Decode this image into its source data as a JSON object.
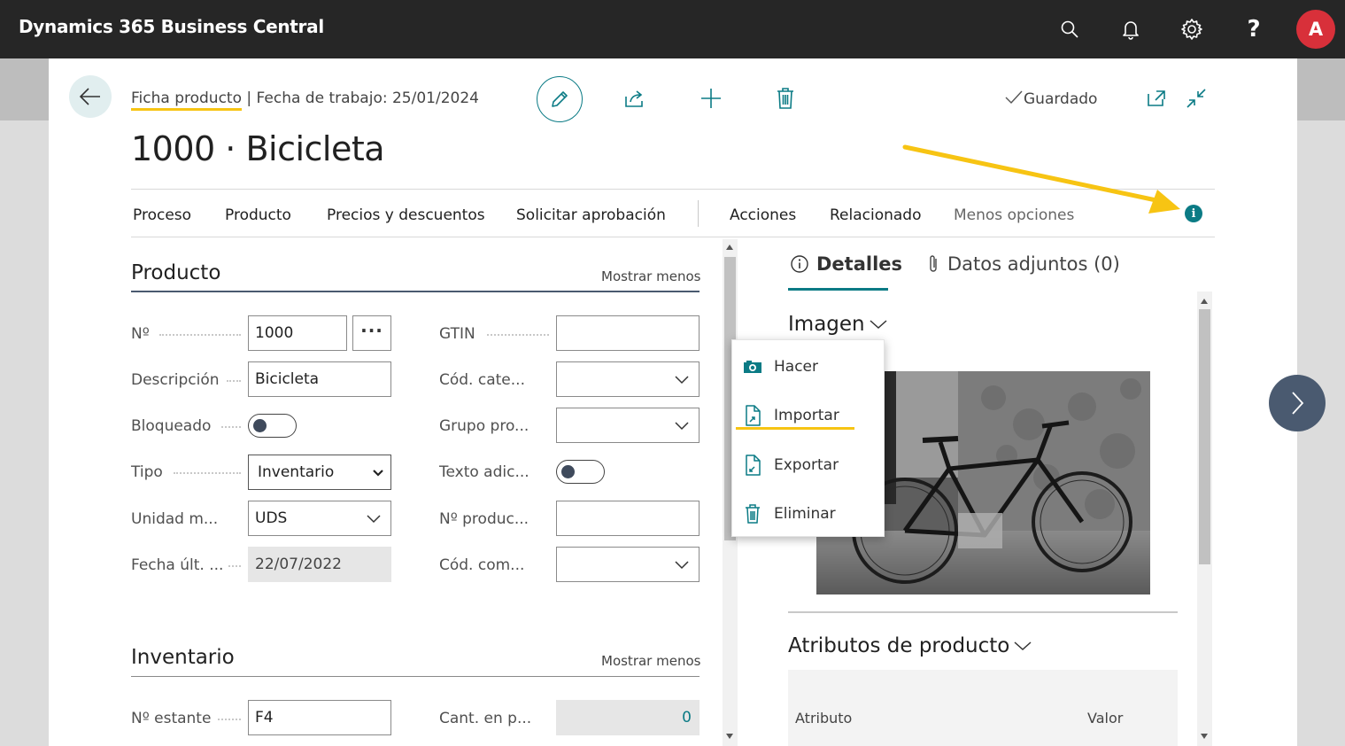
{
  "app": {
    "title": "Dynamics 365 Business Central",
    "avatar_initial": "A",
    "help_glyph": "?"
  },
  "header": {
    "breadcrumb_page": "Ficha producto",
    "breadcrumb_rest": " | Fecha de trabajo: 25/01/2024",
    "title": "1000 · Bicicleta",
    "saved_label": "Guardado"
  },
  "actions": [
    {
      "label": "Proceso"
    },
    {
      "label": "Producto"
    },
    {
      "label": "Precios y descuentos"
    },
    {
      "label": "Solicitar aprobación"
    },
    {
      "label": "Acciones"
    },
    {
      "label": "Relacionado"
    },
    {
      "label": "Menos opciones"
    }
  ],
  "info_glyph": "i",
  "producto": {
    "title": "Producto",
    "toggle_label": "Mostrar menos",
    "fields_left": [
      {
        "label": "Nº",
        "value": "1000"
      },
      {
        "label": "Descripción",
        "value": "Bicicleta"
      },
      {
        "label": "Bloqueado",
        "value": ""
      },
      {
        "label": "Tipo",
        "value": "Inventario"
      },
      {
        "label": "Unidad m...",
        "value": "UDS"
      },
      {
        "label": "Fecha últ. ...",
        "value": "22/07/2022"
      }
    ],
    "ellipsis": "···",
    "fields_right": [
      {
        "label": "GTIN",
        "value": ""
      },
      {
        "label": "Cód. cate...",
        "value": ""
      },
      {
        "label": "Grupo pro...",
        "value": ""
      },
      {
        "label": "Texto adic...",
        "value": ""
      },
      {
        "label": "Nº produc...",
        "value": ""
      },
      {
        "label": "Cód. com...",
        "value": ""
      }
    ]
  },
  "inventario": {
    "title": "Inventario",
    "toggle_label": "Mostrar menos",
    "fields_left": [
      {
        "label": "Nº estante",
        "value": "F4"
      }
    ],
    "fields_right": [
      {
        "label": "Cant. en p...",
        "value": "0"
      }
    ]
  },
  "factbox": {
    "tabs": [
      {
        "label": "Detalles"
      },
      {
        "label": "Datos adjuntos (0)"
      }
    ],
    "image_title": "Imagen",
    "attributes_title": "Atributos de producto",
    "attr_col_name": "Atributo",
    "attr_col_value": "Valor"
  },
  "image_menu": {
    "items": [
      {
        "label": "Hacer",
        "icon": "camera-icon"
      },
      {
        "label": "Importar",
        "icon": "import-file-icon"
      },
      {
        "label": "Exportar",
        "icon": "export-file-icon"
      },
      {
        "label": "Eliminar",
        "icon": "trash-icon"
      }
    ]
  },
  "colors": {
    "accent": "#0b7b85",
    "highlight": "#f7c413",
    "topbar": "#262626",
    "avatar": "#d8303a"
  }
}
